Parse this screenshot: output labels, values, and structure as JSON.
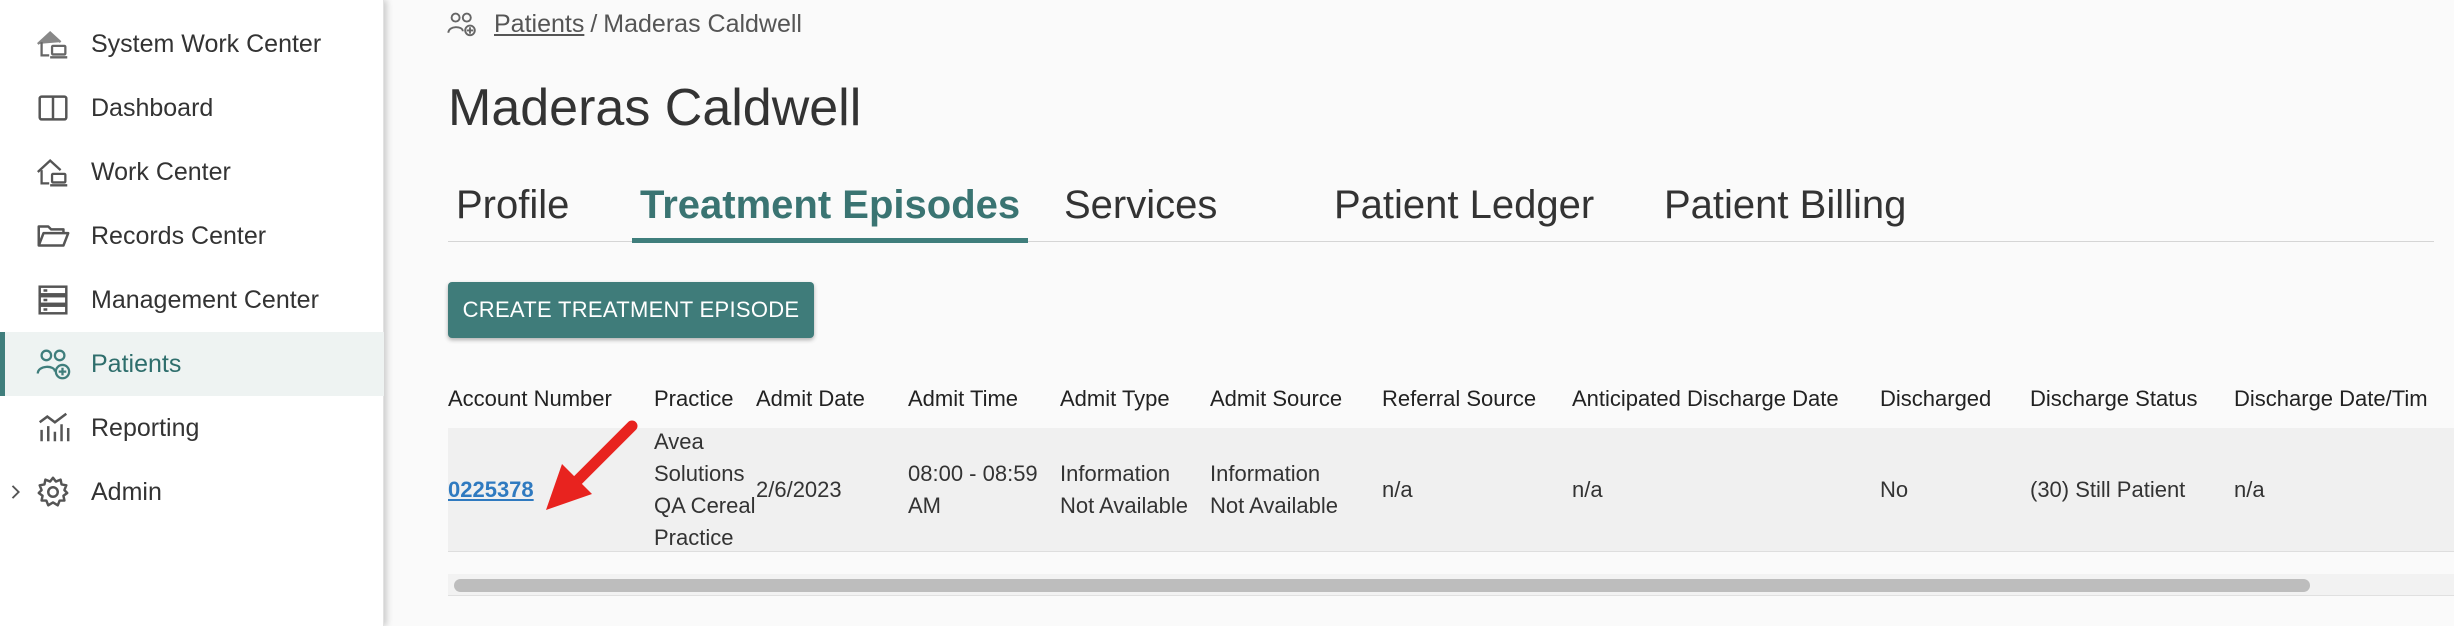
{
  "sidebar": {
    "items": [
      {
        "label": "System Work Center",
        "icon": "home-laptop-icon"
      },
      {
        "label": "Dashboard",
        "icon": "book-open-icon"
      },
      {
        "label": "Work Center",
        "icon": "home-laptop-icon"
      },
      {
        "label": "Records Center",
        "icon": "folder-open-icon"
      },
      {
        "label": "Management Center",
        "icon": "server-stack-icon"
      },
      {
        "label": "Patients",
        "icon": "people-add-icon",
        "active": true
      },
      {
        "label": "Reporting",
        "icon": "bar-chart-trend-icon"
      },
      {
        "label": "Admin",
        "icon": "gear-icon",
        "expandable": true
      }
    ],
    "accent_color": "#3f7e7c"
  },
  "breadcrumb": {
    "parent": "Patients",
    "separator": "/",
    "current": "Maderas Caldwell"
  },
  "page_title": "Maderas Caldwell",
  "tabs": [
    {
      "label": "Profile"
    },
    {
      "label": "Treatment Episodes",
      "active": true
    },
    {
      "label": "Services"
    },
    {
      "label": "Patient Ledger"
    },
    {
      "label": "Patient Billing"
    }
  ],
  "create_button_label": "CREATE TREATMENT EPISODE",
  "table": {
    "headers": [
      "Account Number",
      "Practice",
      "Admit Date",
      "Admit Time",
      "Admit Type",
      "Admit Source",
      "Referral Source",
      "Anticipated Discharge Date",
      "Discharged",
      "Discharge Status",
      "Discharge Date/Tim"
    ],
    "rows": [
      {
        "account_number": "0225378",
        "practice": "Avea Solutions QA Cereal Practice",
        "admit_date": "2/6/2023",
        "admit_time": "08:00 - 08:59 AM",
        "admit_type": "Information Not Available",
        "admit_source": "Information Not Available",
        "referral_source": "n/a",
        "anticipated_discharge_date": "n/a",
        "discharged": "No",
        "discharge_status": "(30) Still Patient",
        "discharge_datetime": "n/a"
      }
    ]
  },
  "colors": {
    "brand_teal": "#3f7c7a",
    "link_blue": "#2f7ac0",
    "annotation_red": "#e8231f"
  }
}
